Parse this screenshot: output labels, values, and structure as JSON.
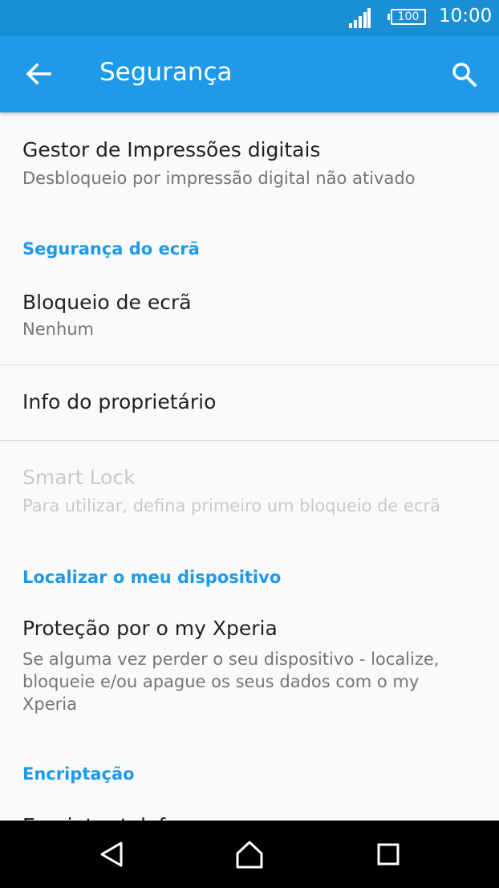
{
  "status_bar": {
    "battery_level": "100",
    "time": "10:00",
    "signal_icon": "signal-full-icon",
    "battery_icon": "battery-icon"
  },
  "app_bar": {
    "title": "Segurança",
    "back_icon": "arrow-back-icon",
    "search_icon": "search-icon",
    "color": "#1e9ae8"
  },
  "items": {
    "fingerprint": {
      "title": "Gestor de Impressões digitais",
      "subtitle": "Desbloqueio por impressão digital não ativado"
    },
    "screen_lock": {
      "title": "Bloqueio de ecrã",
      "subtitle": "Nenhum"
    },
    "owner_info": {
      "title": "Info do proprietário"
    },
    "smart_lock": {
      "title": "Smart Lock",
      "subtitle": "Para utilizar, defina primeiro um bloqueio de ecrã"
    },
    "my_xperia": {
      "title": "Proteção por o my Xperia",
      "subtitle": "Se alguma vez perder o seu dispositivo - localize, bloqueie e/ou apague os seus dados com o my Xperia"
    },
    "encrypt_phone": {
      "title": "Encriptar telefone"
    }
  },
  "sections": {
    "screen_security": "Segurança do ecrã",
    "find_device": "Localizar o meu dispositivo",
    "encryption": "Encriptação"
  },
  "nav_bar": {
    "back_icon": "nav-back-icon",
    "home_icon": "nav-home-icon",
    "recents_icon": "nav-recents-icon"
  }
}
